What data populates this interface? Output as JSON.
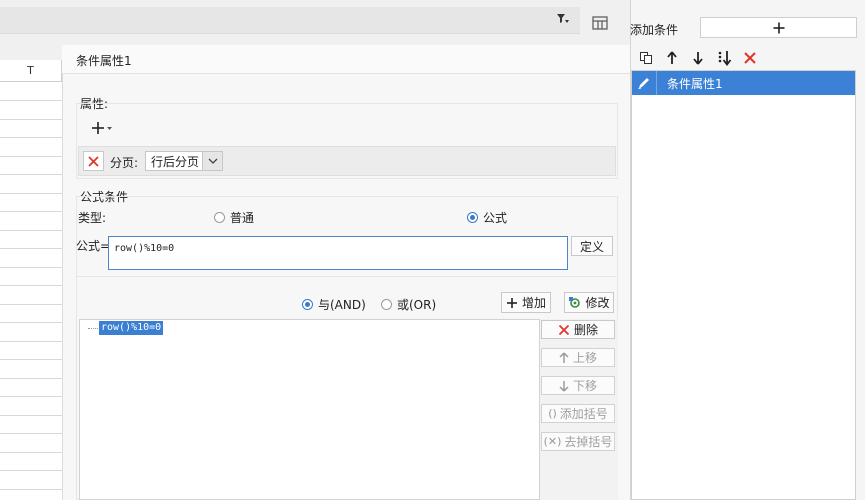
{
  "spreadsheet": {
    "column_header": "T"
  },
  "dialog": {
    "title": "条件属性1",
    "attributes": {
      "group_label": "属性:",
      "rows": [
        {
          "label": "分页:",
          "value": "行后分页"
        }
      ]
    },
    "formula_condition": {
      "group_label": "公式条件",
      "type_label": "类型:",
      "type_options": [
        {
          "label": "普通",
          "selected": false
        },
        {
          "label": "公式",
          "selected": true
        }
      ],
      "formula_label": "公式=",
      "formula_value": "row()%10=0",
      "define_label": "定义",
      "logic_options": [
        {
          "label": "与(AND)",
          "selected": true
        },
        {
          "label": "或(OR)",
          "selected": false
        }
      ],
      "add_label": "增加",
      "modify_label": "修改",
      "delete_label": "删除",
      "move_up_label": "上移",
      "move_down_label": "下移",
      "add_bracket_label": "添加括号",
      "remove_bracket_label": "去掉括号",
      "conditions": [
        "row()%10=0"
      ]
    }
  },
  "right_panel": {
    "add_condition_label": "添加条件",
    "add_condition_button": "+",
    "items": [
      {
        "label": "条件属性1",
        "selected": true
      }
    ]
  },
  "colors": {
    "accent": "#3b82d6",
    "delete_red": "#e0352b",
    "formula_border": "#4a86c8"
  }
}
